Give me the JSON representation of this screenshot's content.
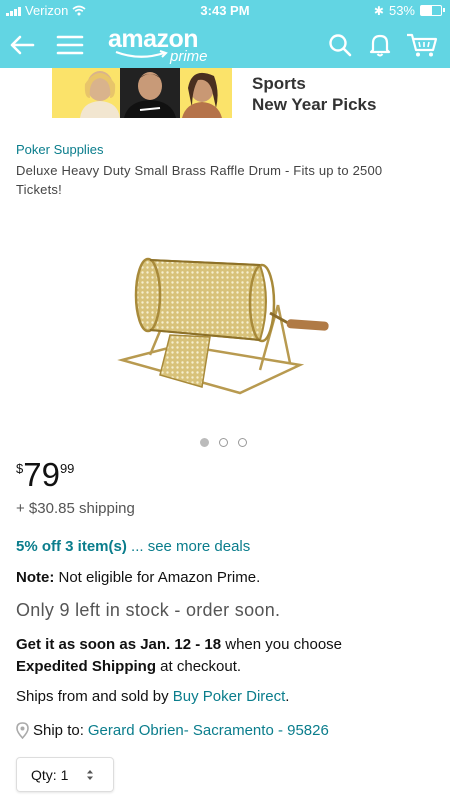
{
  "status_bar": {
    "carrier": "Verizon",
    "time": "3:43 PM",
    "battery": "53%",
    "battery_fill": 0.53
  },
  "nav": {
    "logo_word": "amazon",
    "logo_sub": "prime",
    "icons": [
      "back-arrow-icon",
      "menu-icon",
      "search-icon",
      "bell-icon",
      "cart-icon"
    ]
  },
  "banner": {
    "line1": "Sports",
    "line2": "New Year Picks",
    "background": "#fbe36a"
  },
  "product": {
    "category": "Poker Supplies",
    "title": "Deluxe Heavy Duty Small Brass Raffle Drum - Fits up to 2500 Tickets!",
    "image_count": 3,
    "active_image": 1
  },
  "price": {
    "symbol": "$",
    "whole": "79",
    "fraction": "99"
  },
  "shipping": "+ $30.85 shipping",
  "deals": {
    "highlight": "5% off 3 item(s)",
    "more": " ... see more deals"
  },
  "note": {
    "label": "Note:",
    "text": " Not eligible for Amazon Prime."
  },
  "stock": "Only 9 left in stock - order soon.",
  "delivery": {
    "part1": "Get it as soon as Jan. 12 - 18",
    "part2": " when you choose ",
    "part3": "Expedited Shipping",
    "part4": " at checkout."
  },
  "sold_by": {
    "prefix": "Ships from and sold by ",
    "seller": "Buy Poker Direct",
    "suffix": "."
  },
  "ship_to": {
    "label": "Ship to:",
    "address": "Gerard Obrien- Sacramento - 95826"
  },
  "quantity": {
    "label": "Qty:",
    "value": "1"
  },
  "colors": {
    "header": "#62d5e3",
    "link": "#0a7d8c"
  }
}
